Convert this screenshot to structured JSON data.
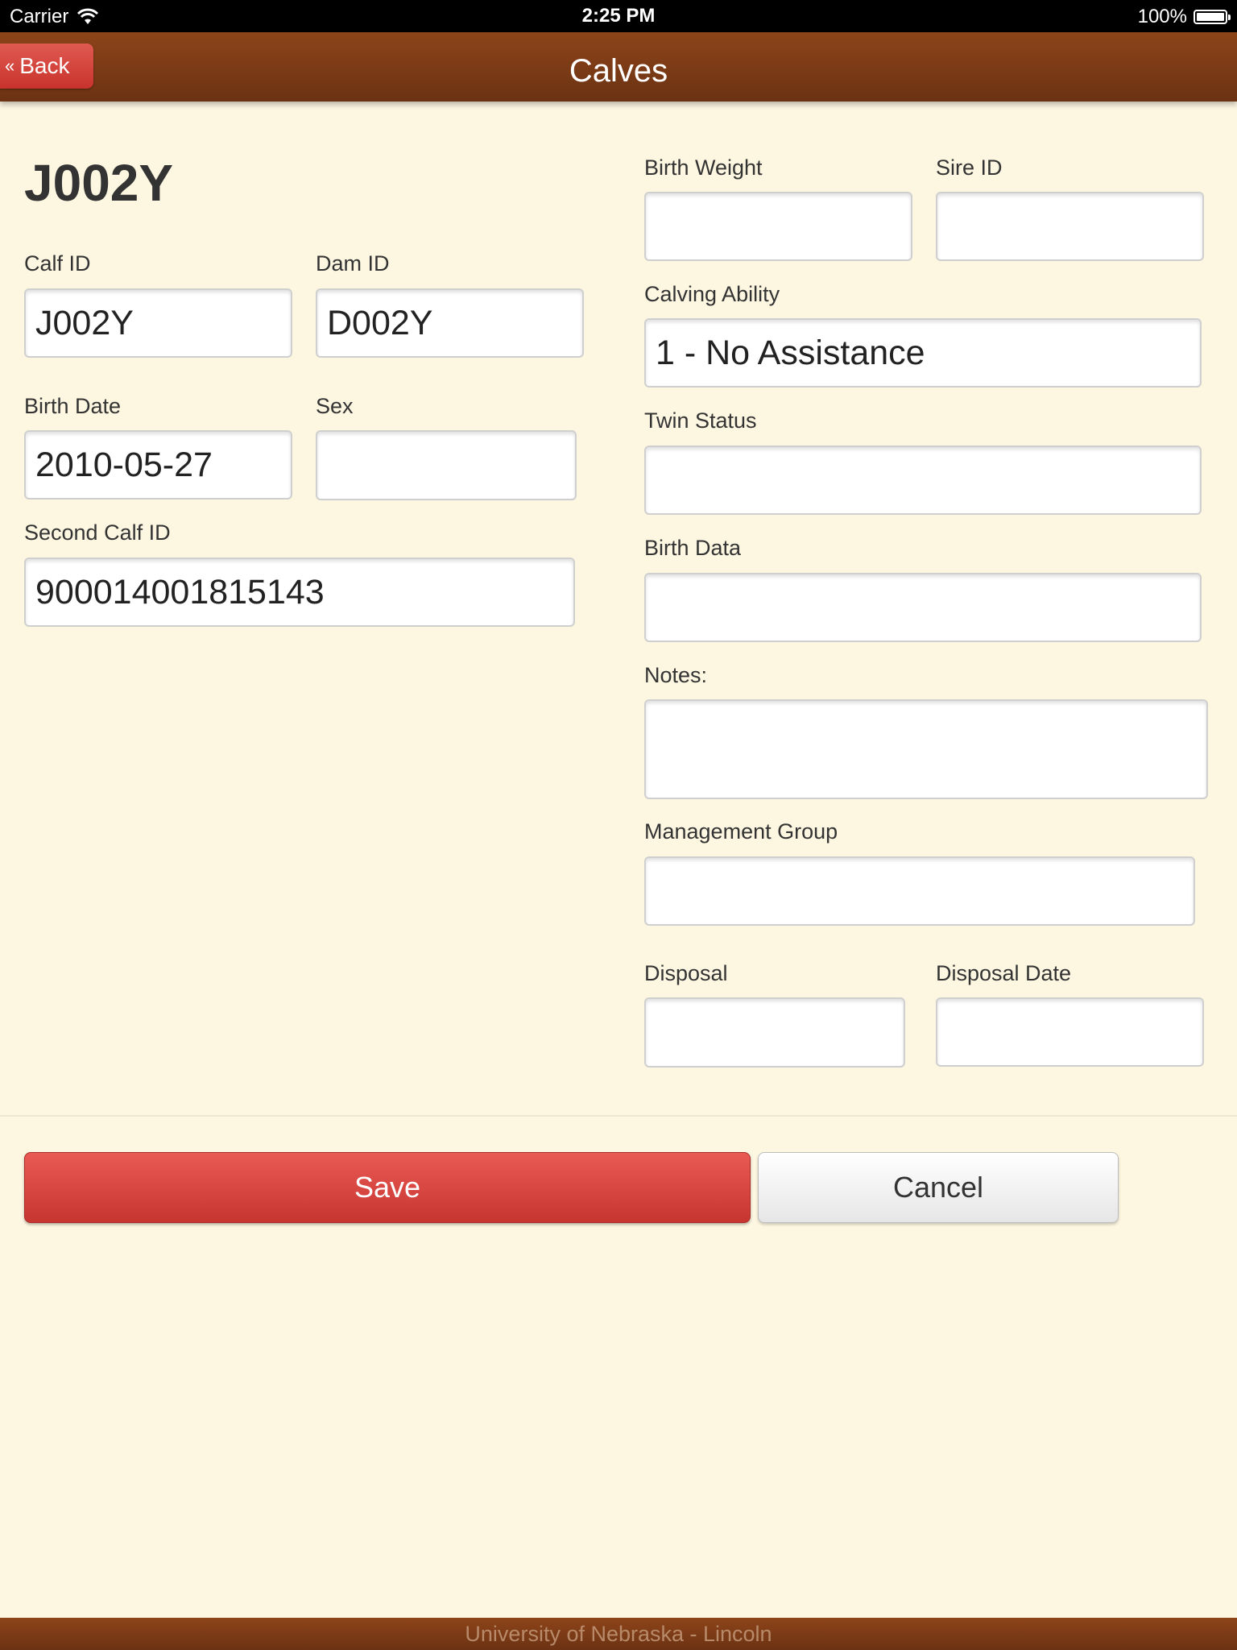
{
  "status_bar": {
    "carrier": "Carrier",
    "time": "2:25 PM",
    "battery": "100%"
  },
  "header": {
    "back_label": "Back",
    "title": "Calves"
  },
  "record": {
    "heading": "J002Y"
  },
  "fields": {
    "calf_id": {
      "label": "Calf ID",
      "value": "J002Y"
    },
    "dam_id": {
      "label": "Dam ID",
      "value": "D002Y"
    },
    "birth_date": {
      "label": "Birth Date",
      "value": "2010-05-27"
    },
    "sex": {
      "label": "Sex",
      "value": ""
    },
    "second_calf_id": {
      "label": "Second Calf ID",
      "value": "900014001815143"
    },
    "birth_weight": {
      "label": "Birth Weight",
      "value": ""
    },
    "sire_id": {
      "label": "Sire ID",
      "value": ""
    },
    "calving_ability": {
      "label": "Calving Ability",
      "value": "1 - No Assistance"
    },
    "twin_status": {
      "label": "Twin Status",
      "value": ""
    },
    "birth_data": {
      "label": "Birth Data",
      "value": ""
    },
    "notes": {
      "label": "Notes:",
      "value": ""
    },
    "management_group": {
      "label": "Management Group",
      "value": ""
    },
    "disposal": {
      "label": "Disposal",
      "value": ""
    },
    "disposal_date": {
      "label": "Disposal Date",
      "value": ""
    }
  },
  "actions": {
    "save_label": "Save",
    "cancel_label": "Cancel"
  },
  "footer": {
    "text": "University of Nebraska - Lincoln"
  },
  "colors": {
    "header_brown": "#7a3a16",
    "background": "#fdf6e1",
    "save_red": "#d9423c"
  }
}
